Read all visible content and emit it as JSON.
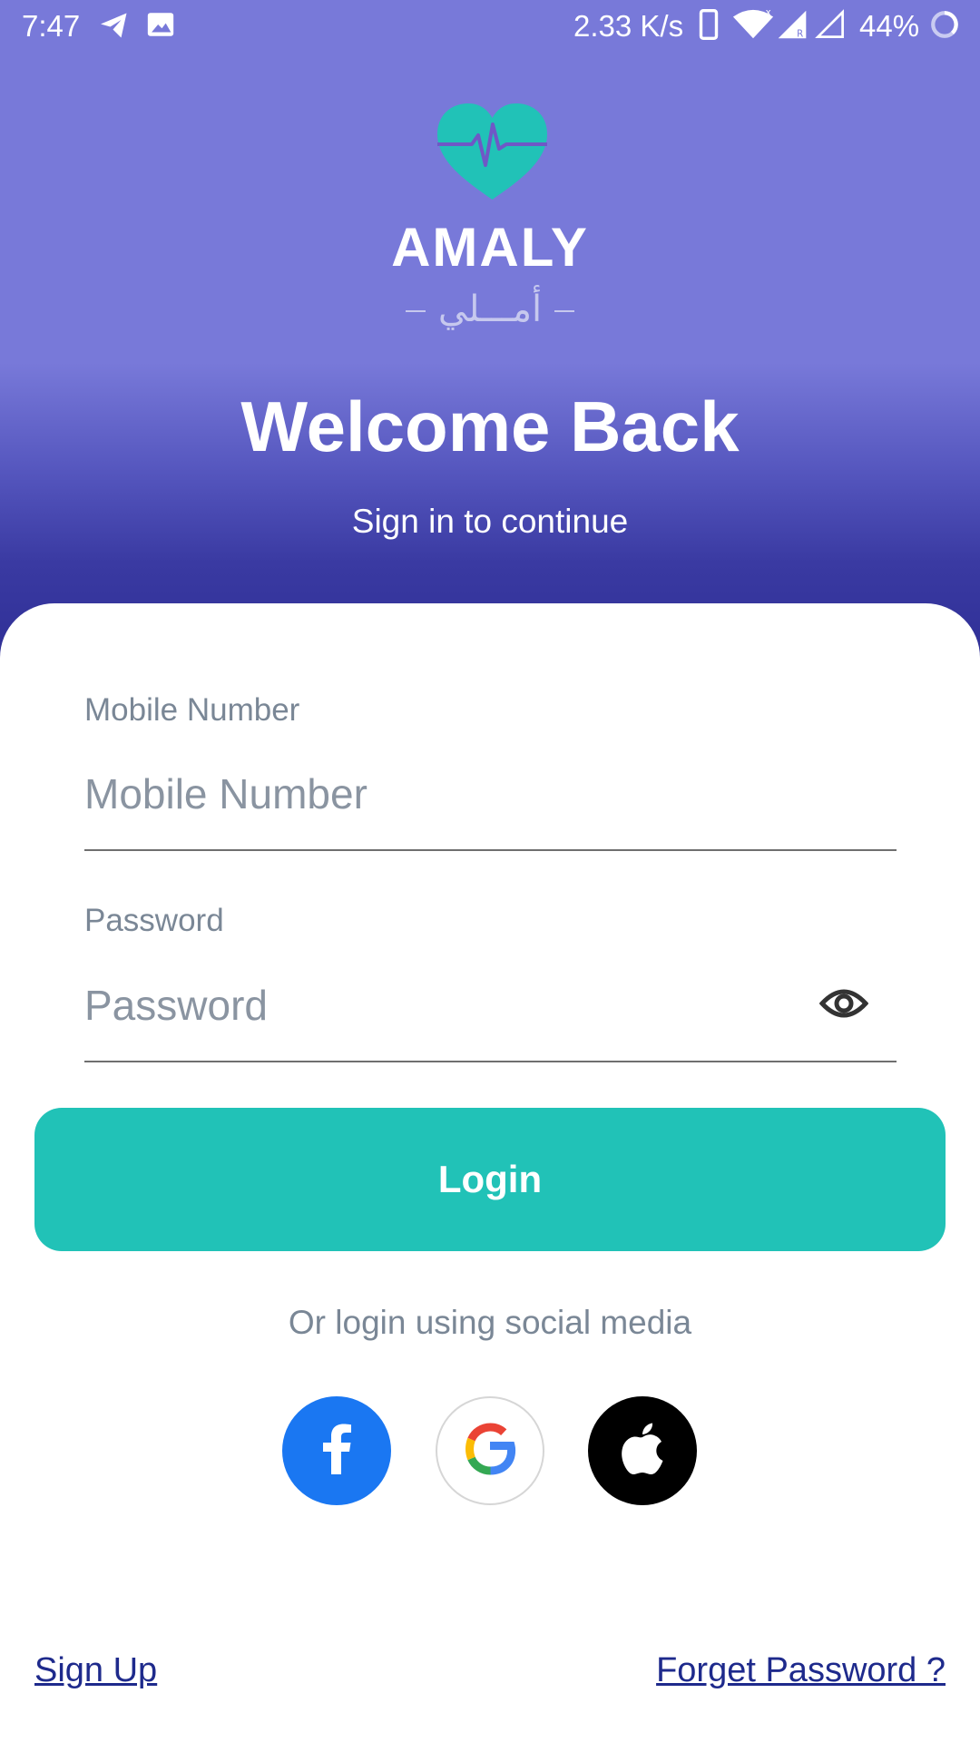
{
  "status_bar": {
    "time": "7:47",
    "network_speed": "2.33 K/s",
    "battery": "44%"
  },
  "brand": {
    "name": "AMALY",
    "name_arabic": "أمـــلي"
  },
  "header": {
    "title": "Welcome Back",
    "subtitle": "Sign in to continue"
  },
  "form": {
    "mobile": {
      "label": "Mobile Number",
      "placeholder": "Mobile Number",
      "value": ""
    },
    "password": {
      "label": "Password",
      "placeholder": "Password",
      "value": ""
    },
    "login_label": "Login"
  },
  "social": {
    "prompt": "Or login using social media",
    "providers": [
      "facebook",
      "google",
      "apple"
    ]
  },
  "footer": {
    "signup_label": "Sign Up",
    "forget_label": "Forget Password ?"
  },
  "colors": {
    "header_top": "#7879d9",
    "header_bottom": "#2e2e95",
    "accent": "#21c2b7",
    "facebook": "#1a77f2",
    "link": "#1e2a8c"
  },
  "icons": {
    "logo": "heart-pulse-icon",
    "password_toggle": "eye-icon",
    "facebook": "facebook-icon",
    "google": "google-icon",
    "apple": "apple-icon"
  }
}
